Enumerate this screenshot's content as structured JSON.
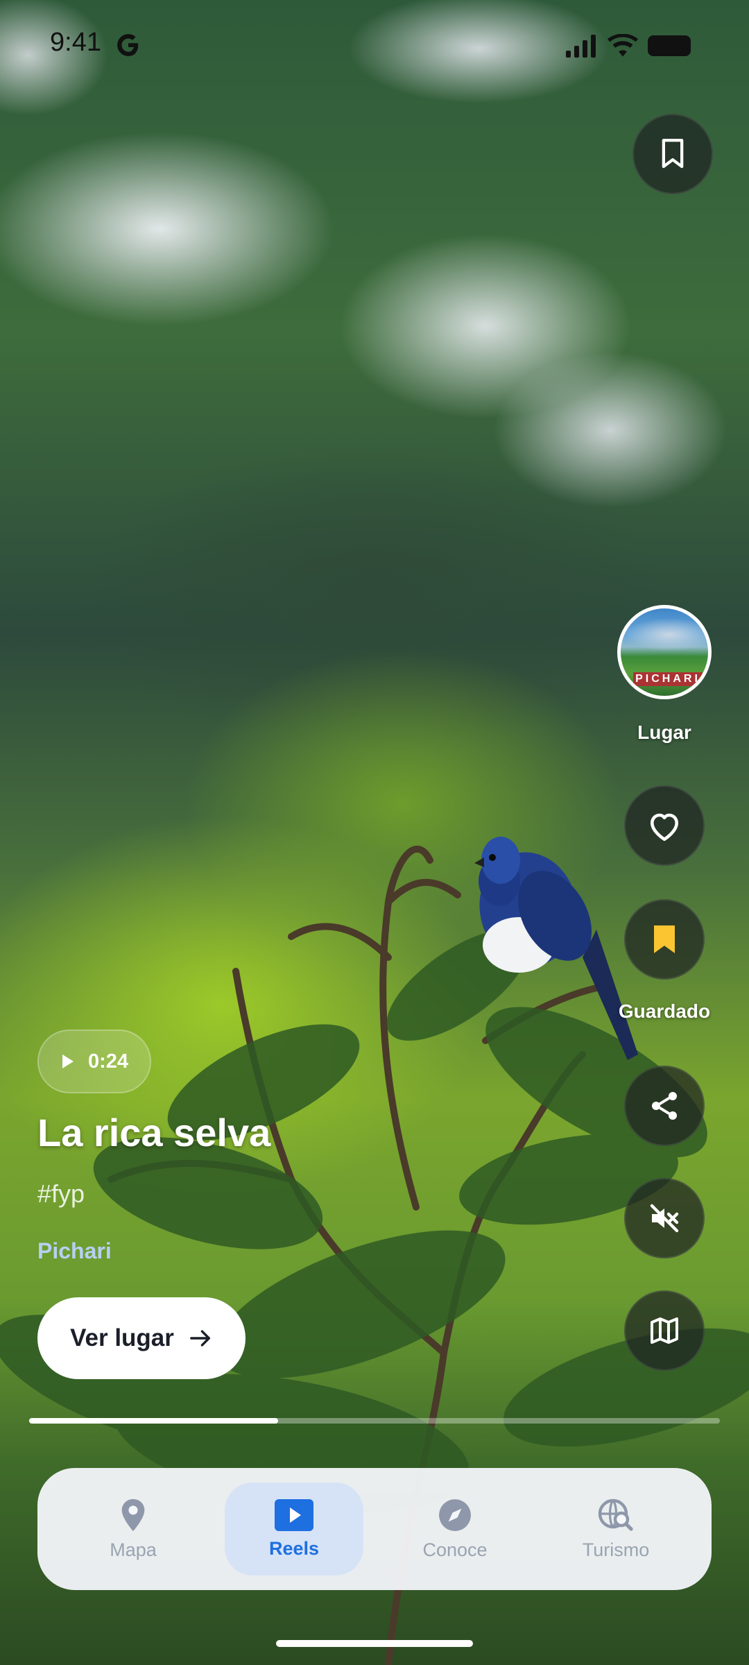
{
  "status_bar": {
    "time": "9:41"
  },
  "video": {
    "duration": "0:24",
    "title": "La rica selva",
    "hashtag": "#fyp",
    "place_name": "Pichari",
    "cta_label": "Ver lugar",
    "progress": 0.36
  },
  "side_actions": {
    "place_label": "Lugar",
    "place_avatar_sign": "PICHARI",
    "saved_label": "Guardado"
  },
  "bottom_nav": {
    "items": [
      {
        "label": "Mapa",
        "icon": "map-pin-icon"
      },
      {
        "label": "Reels",
        "icon": "play-icon"
      },
      {
        "label": "Conoce",
        "icon": "compass-icon"
      },
      {
        "label": "Turismo",
        "icon": "globe-search-icon"
      }
    ],
    "active_index": 1
  },
  "colors": {
    "accent": "#1e6fe0",
    "saved_bookmark": "#fbc531",
    "nav_inactive": "#9aa4b2",
    "place_link": "#b5d0f2"
  }
}
